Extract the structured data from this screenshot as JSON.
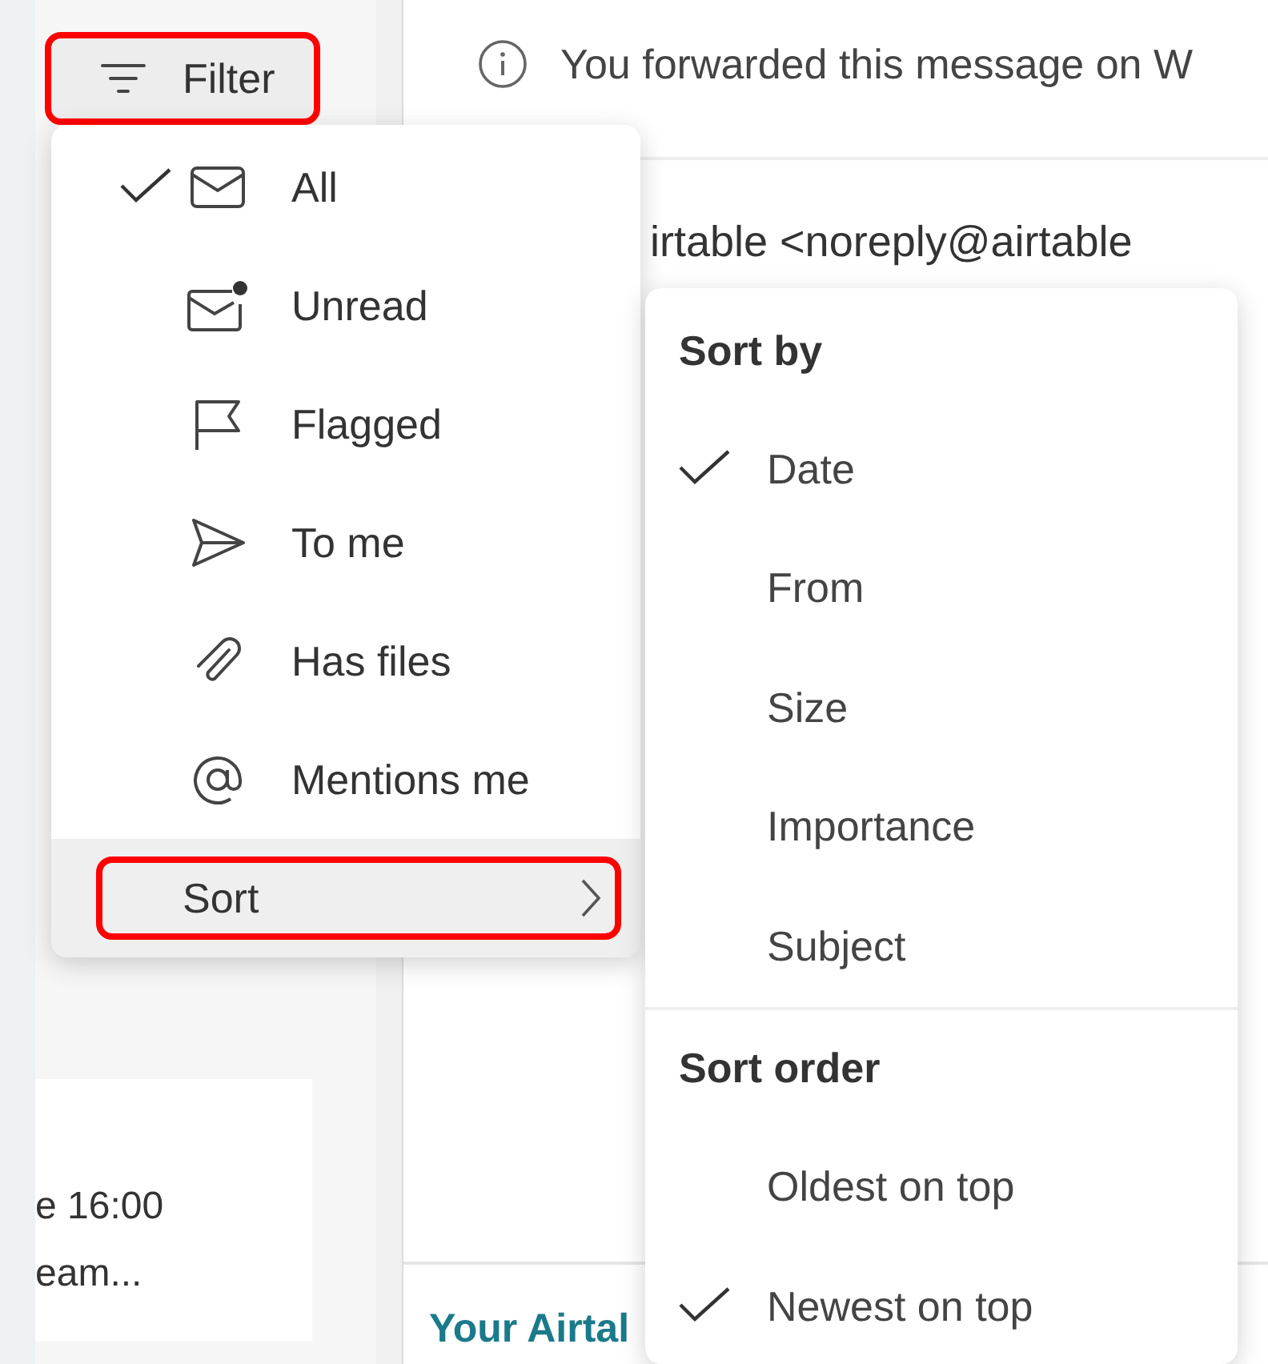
{
  "filter_button": {
    "label": "Filter",
    "highlighted": true
  },
  "info_banner": {
    "text": "You forwarded this message on W"
  },
  "sender": "irtable <noreply@airtable",
  "message_list": {
    "lines": [
      "e 16:00",
      "eam..."
    ]
  },
  "preview_title": "Your Airtal",
  "filter_menu": {
    "items": [
      {
        "label": "All",
        "kind": "all",
        "selected": true
      },
      {
        "label": "Unread",
        "kind": "unread",
        "selected": false
      },
      {
        "label": "Flagged",
        "kind": "flagged",
        "selected": false
      },
      {
        "label": "To me",
        "kind": "tome",
        "selected": false
      },
      {
        "label": "Has files",
        "kind": "files",
        "selected": false
      },
      {
        "label": "Mentions me",
        "kind": "mentions",
        "selected": false
      }
    ],
    "sort_item": {
      "label": "Sort",
      "highlighted": true
    }
  },
  "sort_menu": {
    "sections": [
      {
        "heading": "Sort by",
        "options": [
          {
            "label": "Date",
            "selected": true
          },
          {
            "label": "From",
            "selected": false
          },
          {
            "label": "Size",
            "selected": false
          },
          {
            "label": "Importance",
            "selected": false
          },
          {
            "label": "Subject",
            "selected": false
          }
        ]
      },
      {
        "heading": "Sort order",
        "options": [
          {
            "label": "Oldest on top",
            "selected": false
          },
          {
            "label": "Newest on top",
            "selected": true
          }
        ]
      }
    ]
  }
}
